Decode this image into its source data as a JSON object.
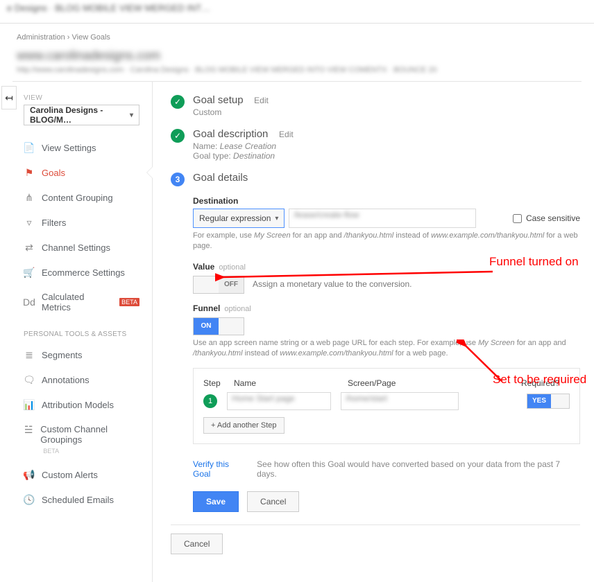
{
  "topbar_blur": "e Designs · BLOG MOBILE VIEW MERGED INT…",
  "breadcrumbs": {
    "admin": "Administration",
    "sep": "›",
    "goals": "View Goals"
  },
  "property_title_blur": "www.carolinadesigns.com",
  "property_sub_blur": "http://www.carolinadesigns.com · Carolina Designs · BLOG MOBILE VIEW MERGED INTO VIEW COMENTX · BOUNCE 20",
  "sidebar": {
    "view_label": "VIEW",
    "view_name": "Carolina Designs - BLOG/M…",
    "items": [
      {
        "icon": "📄",
        "label": "View Settings"
      },
      {
        "icon": "⚑",
        "label": "Goals",
        "active": true
      },
      {
        "icon": "⋔",
        "label": "Content Grouping"
      },
      {
        "icon": "▿",
        "label": "Filters"
      },
      {
        "icon": "⇄",
        "label": "Channel Settings"
      },
      {
        "icon": "🛒",
        "label": "Ecommerce Settings"
      },
      {
        "icon": "Dd",
        "label": "Calculated Metrics",
        "beta": "BETA"
      }
    ],
    "tools_header": "PERSONAL TOOLS & ASSETS",
    "tools": [
      {
        "icon": "≣",
        "label": "Segments"
      },
      {
        "icon": "🗨",
        "label": "Annotations"
      },
      {
        "icon": "📊",
        "label": "Attribution Models"
      },
      {
        "icon": "☱",
        "label": "Custom Channel Groupings",
        "beta_gray": "BETA"
      },
      {
        "icon": "📢",
        "label": "Custom Alerts"
      },
      {
        "icon": "🕓",
        "label": "Scheduled Emails"
      }
    ]
  },
  "steps": {
    "setup": {
      "title": "Goal setup",
      "edit": "Edit",
      "sub": "Custom"
    },
    "desc": {
      "title": "Goal description",
      "edit": "Edit",
      "name_lbl": "Name:",
      "name_val": "Lease Creation",
      "type_lbl": "Goal type:",
      "type_val": "Destination"
    },
    "details": {
      "num": "3",
      "title": "Goal details"
    }
  },
  "destination": {
    "label": "Destination",
    "match": "Regular expression",
    "value_blur": "/lease/create-flow",
    "case_label": "Case sensitive",
    "help_prefix": "For example, use ",
    "help_i1": "My Screen",
    "help_mid1": " for an app and ",
    "help_i2": "/thankyou.html",
    "help_mid2": " instead of ",
    "help_i3": "www.example.com/thankyou.html",
    "help_suffix": " for a web page."
  },
  "value": {
    "label": "Value",
    "optional": "optional",
    "toggle": "OFF",
    "assign": "Assign a monetary value to the conversion."
  },
  "funnel": {
    "label": "Funnel",
    "optional": "optional",
    "toggle": "ON",
    "help_prefix": "Use an app screen name string or a web page URL for each step. For example, use ",
    "help_i1": "My Screen",
    "help_mid1": " for an app and ",
    "help_i2": "/thankyou.html",
    "help_mid2": " instead of ",
    "help_i3": "www.example.com/thankyou.html",
    "help_suffix": " for a web page.",
    "col_step": "Step",
    "col_name": "Name",
    "col_screen": "Screen/Page",
    "col_req": "Required?",
    "row1": {
      "num": "1",
      "name_blur": "Home Start page",
      "screen_blur": "/home/start"
    },
    "req_yes": "YES",
    "add_step": "+ Add another Step"
  },
  "verify": {
    "link": "Verify this Goal",
    "text": "See how often this Goal would have converted based on your data from the past 7 days."
  },
  "buttons": {
    "save": "Save",
    "cancel": "Cancel"
  },
  "footer_cancel": "Cancel",
  "annotations": {
    "funnel_on": "Funnel turned on",
    "required": "Set to be required"
  }
}
